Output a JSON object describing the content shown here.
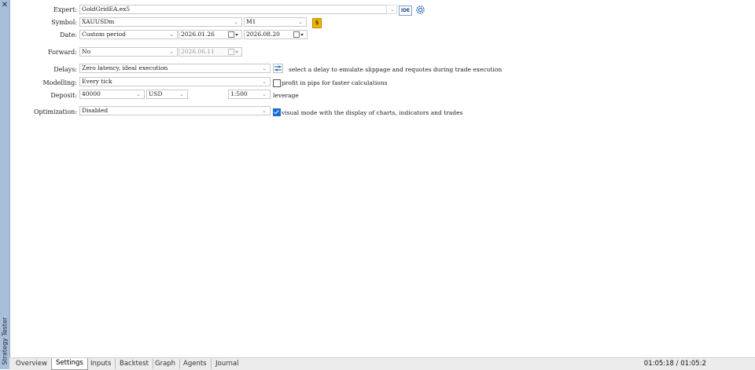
{
  "panel": {
    "title": "Strategy Tester",
    "close_glyph": "✕"
  },
  "settings": {
    "expert": {
      "label": "Expert:",
      "value": "GoldGridEA.ex5"
    },
    "ide_button": "IDE",
    "symbol": {
      "label": "Symbol:",
      "value": "XAUUSDm",
      "timeframe": "M1"
    },
    "date": {
      "label": "Date:",
      "value": "Custom period",
      "from": "2026.01.26",
      "to": "2026.08.20"
    },
    "forward": {
      "label": "Forward:",
      "value": "No",
      "date": "2026.06.11"
    },
    "delays": {
      "label": "Delays:",
      "value": "Zero latency, ideal execution",
      "note": "select a delay to emulate slippage and requotes during trade execution"
    },
    "modelling": {
      "label": "Modelling:",
      "value": "Every tick",
      "option": "profit in pips for faster calculations",
      "option_checked": false
    },
    "deposit": {
      "label": "Deposit:",
      "value": "40000",
      "currency": "USD",
      "leverage": "1:500",
      "leverage_label": "leverage"
    },
    "optimization": {
      "label": "Optimization:",
      "value": "Disabled",
      "option": "visual mode with the display of charts, indicators and trades",
      "option_checked": true
    }
  },
  "tabs": [
    {
      "label": "Overview",
      "active": false
    },
    {
      "label": "Settings",
      "active": true
    },
    {
      "label": "Inputs",
      "active": false
    },
    {
      "label": "Backtest",
      "active": false
    },
    {
      "label": "Graph",
      "active": false
    },
    {
      "label": "Agents",
      "active": false
    },
    {
      "label": "Journal",
      "active": false
    }
  ],
  "status": {
    "clock": "01:05:18 / 01:05:2"
  },
  "colors": {
    "accent": "#1a6ed0",
    "sidebar": "#a9bfd9",
    "symbol_icon": "#f0b400"
  }
}
